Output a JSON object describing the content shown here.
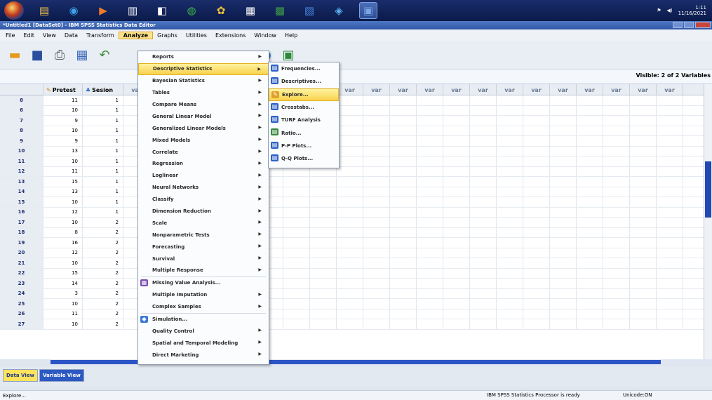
{
  "taskbar": {
    "apps": [
      {
        "icon": "folder-icon"
      },
      {
        "icon": "explorer-icon"
      },
      {
        "icon": "media-icon"
      },
      {
        "icon": "notepad-icon"
      },
      {
        "icon": "paint-icon"
      },
      {
        "icon": "chrome-icon"
      },
      {
        "icon": "app-icon"
      },
      {
        "icon": "calculator-icon"
      },
      {
        "icon": "excel-icon"
      },
      {
        "icon": "word-icon"
      },
      {
        "icon": "network-icon"
      },
      {
        "icon": "spss-icon"
      }
    ],
    "clock": {
      "time": "1:11",
      "date": "11/16/2021"
    }
  },
  "window": {
    "title": "*Untitled1 [DataSet0] - IBM SPSS Statistics Data Editor"
  },
  "menubar": {
    "items": [
      "File",
      "Edit",
      "View",
      "Data",
      "Transform",
      "Analyze",
      "Graphs",
      "Utilities",
      "Extensions",
      "Window",
      "Help"
    ],
    "active": "Analyze"
  },
  "info": {
    "visible_count": "Visible: 2 of 2 Variables"
  },
  "grid": {
    "columns": [
      {
        "name": "Pretest",
        "icon": "scale-icon"
      },
      {
        "name": "Sesion",
        "icon": "nominal-icon"
      }
    ],
    "var_label": "var",
    "rows": [
      {
        "n": "8",
        "a": "11",
        "b": "1"
      },
      {
        "n": "6",
        "a": "10",
        "b": "1"
      },
      {
        "n": "7",
        "a": "9",
        "b": "1"
      },
      {
        "n": "8",
        "a": "10",
        "b": "1"
      },
      {
        "n": "9",
        "a": "9",
        "b": "1"
      },
      {
        "n": "10",
        "a": "13",
        "b": "1"
      },
      {
        "n": "11",
        "a": "10",
        "b": "1"
      },
      {
        "n": "12",
        "a": "11",
        "b": "1"
      },
      {
        "n": "13",
        "a": "15",
        "b": "1"
      },
      {
        "n": "14",
        "a": "13",
        "b": "1"
      },
      {
        "n": "15",
        "a": "10",
        "b": "1"
      },
      {
        "n": "16",
        "a": "12",
        "b": "1"
      },
      {
        "n": "17",
        "a": "10",
        "b": "2"
      },
      {
        "n": "18",
        "a": "8",
        "b": "2"
      },
      {
        "n": "19",
        "a": "16",
        "b": "2"
      },
      {
        "n": "20",
        "a": "12",
        "b": "2"
      },
      {
        "n": "21",
        "a": "10",
        "b": "2"
      },
      {
        "n": "22",
        "a": "15",
        "b": "2"
      },
      {
        "n": "23",
        "a": "14",
        "b": "2"
      },
      {
        "n": "24",
        "a": "3",
        "b": "2"
      },
      {
        "n": "25",
        "a": "10",
        "b": "2"
      },
      {
        "n": "26",
        "a": "11",
        "b": "2"
      },
      {
        "n": "27",
        "a": "10",
        "b": "2"
      }
    ]
  },
  "analyze_menu": {
    "items": [
      {
        "label": "Reports",
        "submenu": true,
        "hl": false,
        "icon": ""
      },
      {
        "label": "Descriptive Statistics",
        "submenu": true,
        "hl": true,
        "icon": ""
      },
      {
        "label": "Bayesian Statistics",
        "submenu": true,
        "hl": false,
        "icon": ""
      },
      {
        "label": "Tables",
        "submenu": true,
        "hl": false,
        "icon": ""
      },
      {
        "label": "Compare Means",
        "submenu": true,
        "hl": false,
        "icon": ""
      },
      {
        "label": "General Linear Model",
        "submenu": true,
        "hl": false,
        "icon": ""
      },
      {
        "label": "Generalized Linear Models",
        "submenu": true,
        "hl": false,
        "icon": ""
      },
      {
        "label": "Mixed Models",
        "submenu": true,
        "hl": false,
        "icon": ""
      },
      {
        "label": "Correlate",
        "submenu": true,
        "hl": false,
        "icon": ""
      },
      {
        "label": "Regression",
        "submenu": true,
        "hl": false,
        "icon": ""
      },
      {
        "label": "Loglinear",
        "submenu": true,
        "hl": false,
        "icon": ""
      },
      {
        "label": "Neural Networks",
        "submenu": true,
        "hl": false,
        "icon": ""
      },
      {
        "label": "Classify",
        "submenu": true,
        "hl": false,
        "icon": ""
      },
      {
        "label": "Dimension Reduction",
        "submenu": true,
        "hl": false,
        "icon": ""
      },
      {
        "label": "Scale",
        "submenu": true,
        "hl": false,
        "icon": ""
      },
      {
        "label": "Nonparametric Tests",
        "submenu": true,
        "hl": false,
        "icon": ""
      },
      {
        "label": "Forecasting",
        "submenu": true,
        "hl": false,
        "icon": ""
      },
      {
        "label": "Survival",
        "submenu": true,
        "hl": false,
        "icon": ""
      },
      {
        "label": "Multiple Response",
        "submenu": true,
        "hl": false,
        "icon": ""
      },
      {
        "label": "Missing Value Analysis...",
        "submenu": false,
        "hl": false,
        "icon": "missing-value-icon"
      },
      {
        "label": "Multiple Imputation",
        "submenu": true,
        "hl": false,
        "icon": ""
      },
      {
        "label": "Complex Samples",
        "submenu": true,
        "hl": false,
        "icon": ""
      },
      {
        "label": "Simulation...",
        "submenu": false,
        "hl": false,
        "icon": "simulation-icon"
      },
      {
        "label": "Quality Control",
        "submenu": true,
        "hl": false,
        "icon": ""
      },
      {
        "label": "Spatial and Temporal Modeling",
        "submenu": true,
        "hl": false,
        "icon": ""
      },
      {
        "label": "Direct Marketing",
        "submenu": true,
        "hl": false,
        "icon": ""
      }
    ]
  },
  "descriptive_menu": {
    "items": [
      {
        "label": "Frequencies...",
        "icon": "frequencies-icon",
        "hl": false
      },
      {
        "label": "Descriptives...",
        "icon": "descriptives-icon",
        "hl": false
      },
      {
        "label": "Explore...",
        "icon": "explore-icon",
        "hl": true
      },
      {
        "label": "Crosstabs...",
        "icon": "crosstabs-icon",
        "hl": false
      },
      {
        "label": "TURF Analysis",
        "icon": "turf-icon",
        "hl": false
      },
      {
        "label": "Ratio...",
        "icon": "ratio-icon",
        "hl": false
      },
      {
        "label": "P-P Plots...",
        "icon": "pp-plots-icon",
        "hl": false
      },
      {
        "label": "Q-Q Plots...",
        "icon": "qq-plots-icon",
        "hl": false
      }
    ]
  },
  "tabs": [
    {
      "label": "Data View",
      "active": true
    },
    {
      "label": "Variable View",
      "active": false
    }
  ],
  "status": {
    "left": "Explore...",
    "processor": "IBM SPSS Statistics Processor is ready",
    "unicode": "Unicode:ON"
  }
}
